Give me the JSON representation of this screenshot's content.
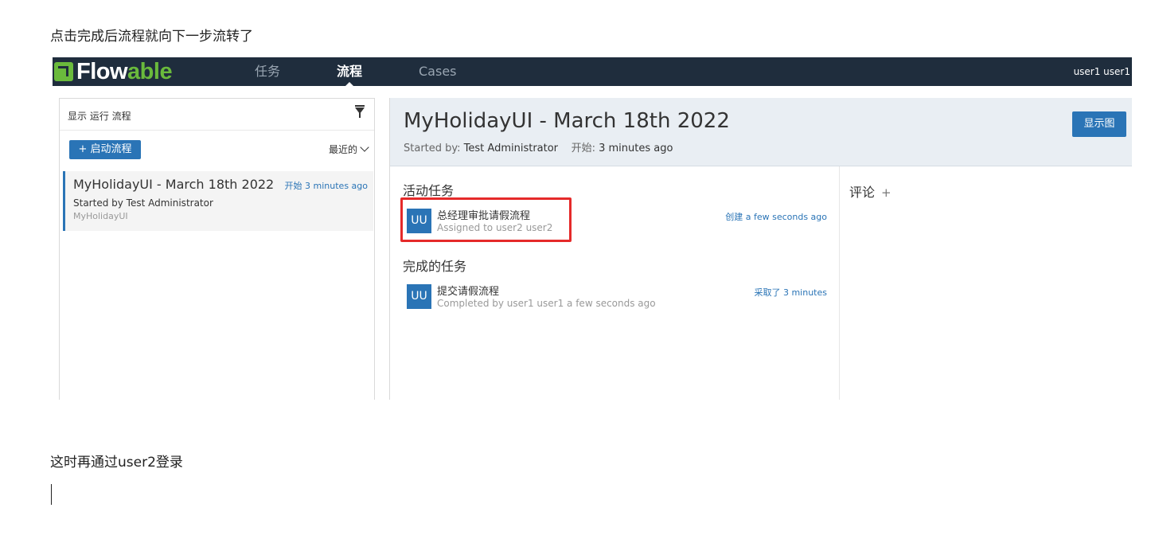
{
  "doc": {
    "intro_text": "点击完成后流程就向下一步流转了",
    "after_text": "这时再通过user2登录"
  },
  "app": {
    "logo_flow": "Flow",
    "logo_able": "able",
    "nav": [
      {
        "label": "任务",
        "active": false
      },
      {
        "label": "流程",
        "active": true
      },
      {
        "label": "Cases",
        "active": false
      }
    ],
    "user": "user1 user1"
  },
  "left_panel": {
    "filter_label": "显示 运行 流程",
    "start_button": "+ 启动流程",
    "sort_label": "最近的",
    "process": {
      "title": "MyHolidayUI - March 18th 2022",
      "time": "开始 3 minutes ago",
      "started_by": "Started by Test Administrator",
      "definition": "MyHolidayUI"
    }
  },
  "detail": {
    "title": "MyHolidayUI - March 18th 2022",
    "started_by_label": "Started by:",
    "started_by_value": "Test Administrator",
    "start_label": "开始:",
    "start_value": "3 minutes ago",
    "diagram_button": "显示图",
    "active_tasks_heading": "活动任务",
    "active_task": {
      "avatar": "UU",
      "name": "总经理审批请假流程",
      "sub": "Assigned to user2 user2",
      "time": "创建 a few seconds ago"
    },
    "completed_heading": "完成的任务",
    "completed_task": {
      "avatar": "UU",
      "name": "提交请假流程",
      "sub": "Completed by user1 user1 a few seconds ago",
      "time": "采取了 3 minutes"
    },
    "comments_heading": "评论",
    "comments_add": "+"
  },
  "colors": {
    "navbar": "#1f2d3d",
    "primary": "#2a74b6",
    "logo_green": "#6aba3c",
    "highlight_red": "#e52a2a"
  }
}
